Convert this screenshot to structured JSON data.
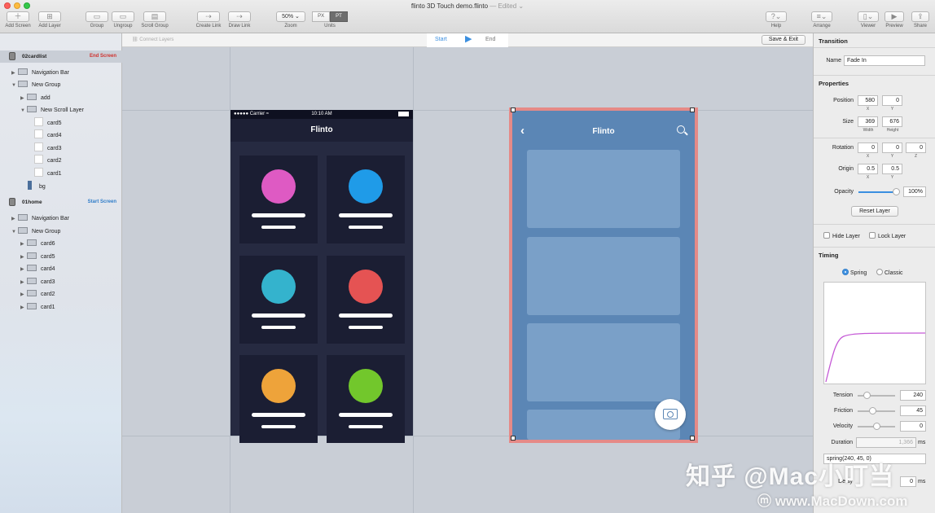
{
  "window": {
    "title": "flinto 3D Touch demo.flinto",
    "edited": "— Edited ⌄"
  },
  "toolbar": {
    "add_screen": "Add Screen",
    "add_layer": "Add Layer",
    "group": "Group",
    "ungroup": "Ungroup",
    "scroll_group": "Scroll Group",
    "create_link": "Create Link",
    "draw_link": "Draw Link",
    "zoom_value": "50%",
    "zoom_label": "Zoom",
    "units_px": "PX",
    "units_pt": "PT",
    "units_label": "Units",
    "help": "Help",
    "arrange": "Arrange",
    "viewer": "Viewer",
    "preview": "Preview",
    "share": "Share"
  },
  "subbar": {
    "connect_layers": "Connect Layers",
    "start": "Start",
    "end": "End",
    "save_exit": "Save & Exit"
  },
  "sidebar": {
    "screen1": {
      "name": "02cardlist",
      "tag": "End Screen"
    },
    "screen1_layers": [
      "Navigation Bar",
      "New Group",
      "add",
      "New Scroll Layer",
      "card5",
      "card4",
      "card3",
      "card2",
      "card1",
      "bg"
    ],
    "screen2": {
      "name": "01home",
      "tag": "Start Screen"
    },
    "screen2_layers": [
      "Navigation Bar",
      "New Group",
      "card6",
      "card5",
      "card4",
      "card3",
      "card2",
      "card1"
    ]
  },
  "phone1": {
    "carrier": "●●●●● Carrier ≈",
    "time": "10:10 AM",
    "title": "Flinto"
  },
  "phone2": {
    "title": "Flinto"
  },
  "colors": {
    "dot1": "#de5ac3",
    "dot2": "#1f9be8",
    "dot3": "#34b3cd",
    "dot4": "#e55353",
    "dot5": "#eea33a",
    "dot6": "#72c72c",
    "curve": "#c55ad6",
    "selection": "#e58a87"
  },
  "panel": {
    "transition_h": "Transition",
    "name_label": "Name",
    "name_value": "Fade In",
    "properties_h": "Properties",
    "position_label": "Position",
    "pos_x": "580",
    "pos_y": "0",
    "x": "X",
    "y": "Y",
    "size_label": "Size",
    "width": "369",
    "height": "676",
    "width_sub": "Width",
    "height_sub": "Height",
    "rotation_label": "Rotation",
    "rot_x": "0",
    "rot_y": "0",
    "rot_z": "0",
    "z": "Z",
    "origin_label": "Origin",
    "origin_x": "0.5",
    "origin_y": "0.5",
    "opacity_label": "Opacity",
    "opacity_value": "100%",
    "opacity_level": 1.0,
    "reset_layer": "Reset Layer",
    "hide_layer": "Hide Layer",
    "lock_layer": "Lock Layer",
    "timing_h": "Timing",
    "spring": "Spring",
    "classic": "Classic",
    "tension_label": "Tension",
    "tension_value": "240",
    "friction_label": "Friction",
    "friction_value": "45",
    "velocity_label": "Velocity",
    "velocity_value": "0",
    "duration_label": "Duration",
    "duration_value": "1,366",
    "ms": "ms",
    "spring_expr": "spring(240, 45, 0)",
    "delay_label": "Delay",
    "delay_value": "0"
  },
  "watermark": {
    "line1": "知乎 @Mac小叮当",
    "line2": "ⓜ www.MacDown.com"
  }
}
